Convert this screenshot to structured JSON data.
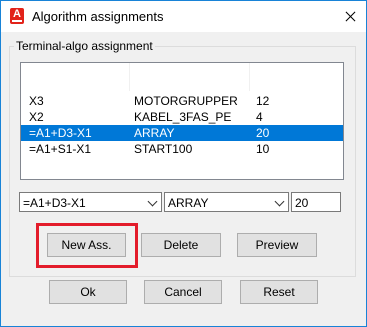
{
  "window": {
    "title": "Algorithm assignments"
  },
  "group": {
    "label": "Terminal-algo assignment"
  },
  "list": {
    "rows": [
      {
        "terminal": "X3",
        "algo": "MOTORGRUPPER",
        "num": "12",
        "selected": false
      },
      {
        "terminal": "X2",
        "algo": "KABEL_3FAS_PE",
        "num": "4",
        "selected": false
      },
      {
        "terminal": "=A1+D3-X1",
        "algo": "ARRAY",
        "num": "20",
        "selected": true
      },
      {
        "terminal": "=A1+S1-X1",
        "algo": "START100",
        "num": "10",
        "selected": false
      }
    ]
  },
  "editor": {
    "terminal_value": "=A1+D3-X1",
    "algo_value": "ARRAY",
    "num_value": "20"
  },
  "buttons": {
    "new_ass": "New Ass.",
    "delete": "Delete",
    "preview": "Preview",
    "ok": "Ok",
    "cancel": "Cancel",
    "reset": "Reset"
  },
  "colors": {
    "selection": "#0078d7",
    "highlight": "#e31c2b",
    "window_border": "#1883d7"
  },
  "icons": {
    "app": "autocad-electrical-icon",
    "close": "close-icon"
  }
}
